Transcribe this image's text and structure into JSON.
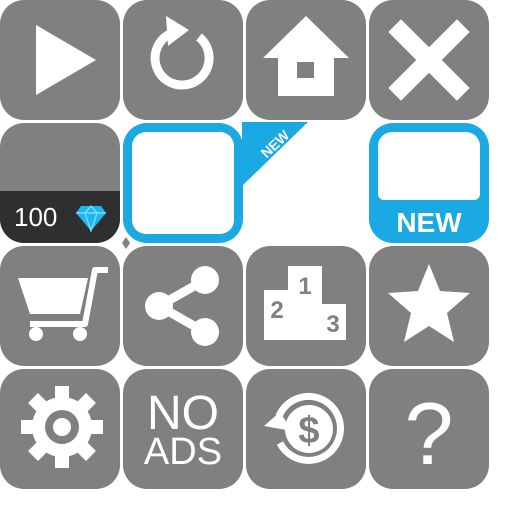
{
  "row2": {
    "price_value": "100",
    "currency_icon": "diamond-icon",
    "new_ribbon_text": "NEW",
    "new_tab_text": "NEW"
  },
  "row4": {
    "no_ads_line1": "NO",
    "no_ads_line2": "ADS",
    "help_text": "?"
  },
  "podium": {
    "first": "1",
    "second": "2",
    "third": "3"
  },
  "icons": [
    "play-icon",
    "restart-icon",
    "home-icon",
    "close-icon",
    "cart-icon",
    "share-icon",
    "podium-icon",
    "star-icon",
    "gear-icon",
    "no-ads-icon",
    "restore-purchase-icon",
    "help-icon"
  ],
  "colors": {
    "tile_gray": "#808080",
    "accent_blue": "#1aa9e3",
    "price_dark": "#2f2f2f",
    "diamond": "#1fb7f0",
    "icon_white": "#ffffff"
  }
}
